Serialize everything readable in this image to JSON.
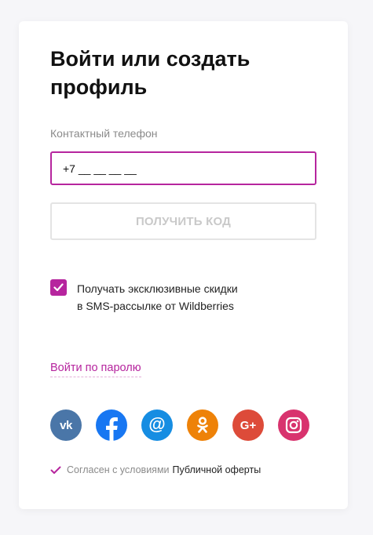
{
  "title": "Войти или создать профиль",
  "phone": {
    "label": "Контактный телефон",
    "value": "+7 __ __ __ __"
  },
  "get_code_button": "ПОЛУЧИТЬ КОД",
  "sms_checkbox": {
    "checked": true,
    "line1": "Получать эксклюзивные скидки",
    "line2": "в SMS-рассылке от Wildberries"
  },
  "password_link": "Войти по паролю",
  "socials": {
    "vk": "vk",
    "gplus": "G+",
    "mail": "@"
  },
  "agreement": {
    "text": "Согласен с условиями",
    "link": "Публичной оферты"
  },
  "colors": {
    "accent": "#b6259e",
    "vk": "#4a76a8",
    "facebook": "#1877f2",
    "mail": "#168de2",
    "odnoklassniki": "#ee8208",
    "google_plus": "#dd4b39",
    "instagram": "#d8336e"
  },
  "icons": [
    "check-icon",
    "vk-icon",
    "facebook-icon",
    "mail-ru-icon",
    "odnoklassniki-icon",
    "google-plus-icon",
    "instagram-icon"
  ]
}
